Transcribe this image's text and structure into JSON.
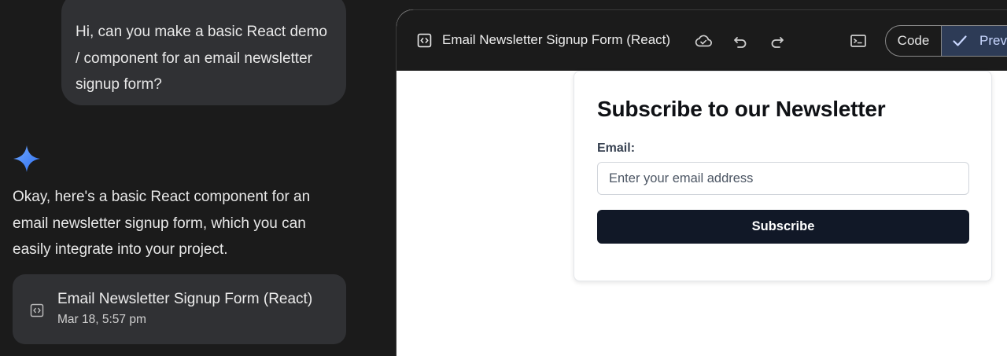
{
  "chat": {
    "user_message": "Hi, can you make a basic React demo / component for an email newsletter signup form?",
    "assistant_icon": "gemini-spark-icon",
    "assistant_reply": "Okay, here's a basic React component for an email newsletter signup form, which you can easily integrate into your project.",
    "artifact": {
      "icon": "code-icon",
      "title": "Email Newsletter Signup Form (React)",
      "date": "Mar 18, 5:57 pm"
    }
  },
  "canvas": {
    "toolbar": {
      "icon": "code-icon",
      "title": "Email Newsletter Signup Form (React)",
      "buttons": [
        "cloud-icon",
        "undo-icon",
        "redo-icon",
        "terminal-icon"
      ],
      "code_label": "Code",
      "preview_label": "Preview"
    },
    "form": {
      "title": "Subscribe to our Newsletter",
      "email_label": "Email:",
      "email_placeholder": "Enter your email address",
      "email_value": "",
      "submit_label": "Subscribe"
    }
  },
  "colors": {
    "app_bg": "#1b1b1b",
    "bubble_bg": "#303134",
    "accent_blue": "#4f8df5",
    "preview_segment_bg": "#2d3b56",
    "button_dark": "#111827"
  }
}
